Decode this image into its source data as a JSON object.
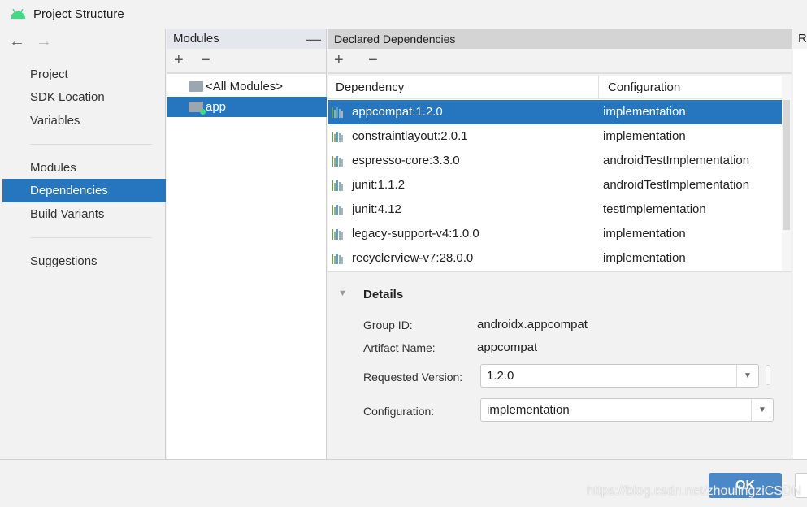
{
  "window": {
    "title": "Project Structure",
    "accent": "#2675bf"
  },
  "sidebar": {
    "items": [
      {
        "label": "Project"
      },
      {
        "label": "SDK Location"
      },
      {
        "label": "Variables"
      },
      {
        "label": "Modules"
      },
      {
        "label": "Dependencies",
        "selected": true
      },
      {
        "label": "Build Variants"
      },
      {
        "label": "Suggestions"
      }
    ]
  },
  "modules": {
    "title": "Modules",
    "add": "+",
    "remove": "−",
    "items": [
      {
        "label": "<All Modules>"
      },
      {
        "label": "app",
        "selected": true
      }
    ]
  },
  "deps": {
    "title": "Declared Dependencies",
    "add": "+",
    "remove": "−",
    "columns": [
      "Dependency",
      "Configuration"
    ],
    "rows": [
      {
        "dependency": "appcompat:1.2.0",
        "configuration": "implementation",
        "selected": true
      },
      {
        "dependency": "constraintlayout:2.0.1",
        "configuration": "implementation"
      },
      {
        "dependency": "espresso-core:3.3.0",
        "configuration": "androidTestImplementation"
      },
      {
        "dependency": "junit:1.1.2",
        "configuration": "androidTestImplementation"
      },
      {
        "dependency": "junit:4.12",
        "configuration": "testImplementation"
      },
      {
        "dependency": "legacy-support-v4:1.0.0",
        "configuration": "implementation"
      },
      {
        "dependency": "recyclerview-v7:28.0.0",
        "configuration": "implementation"
      }
    ]
  },
  "details": {
    "title": "Details",
    "group_label": "Group ID:",
    "group": "androidx.appcompat",
    "artifact_label": "Artifact Name:",
    "artifact": "appcompat",
    "version_label": "Requested Version:",
    "version": "1.2.0",
    "config_label": "Configuration:",
    "config": "implementation"
  },
  "right_panel": {
    "title": "R"
  },
  "footer": {
    "ok": "OK"
  },
  "watermark": "https://blog.csdn.net/zhoulingziCSDN"
}
